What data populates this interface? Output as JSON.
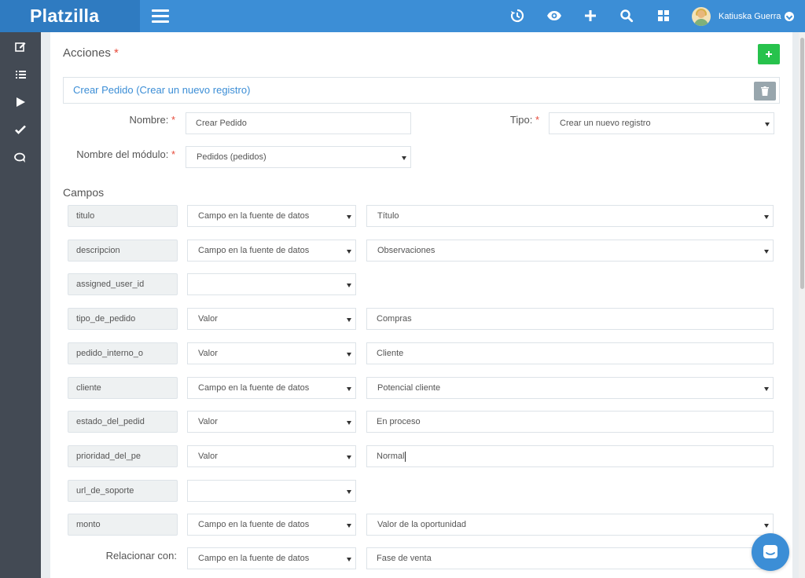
{
  "app": {
    "brand": "Platzilla"
  },
  "user": {
    "name": "Katiuska Guerra"
  },
  "topbar_icons": [
    "history-icon",
    "eye-icon",
    "plus-icon",
    "search-icon",
    "grid-icon"
  ],
  "sidebar_icons": [
    "edit-icon",
    "list-icon",
    "play-icon",
    "check-icon",
    "comments-icon"
  ],
  "page": {
    "title": "Acciones",
    "required_mark": "*"
  },
  "action": {
    "title": "Crear Pedido (Crear un nuevo registro)"
  },
  "form": {
    "nombre_label": "Nombre:",
    "nombre_value": "Crear Pedido",
    "tipo_label": "Tipo:",
    "tipo_value": "Crear un nuevo registro",
    "modulo_label": "Nombre del módulo:",
    "modulo_value": "Pedidos (pedidos)"
  },
  "campos": {
    "title": "Campos",
    "rows": [
      {
        "field": "titulo",
        "source": "Campo en la fuente de datos",
        "value": "Título",
        "value_type": "select"
      },
      {
        "field": "descripcion",
        "source": "Campo en la fuente de datos",
        "value": "Observaciones",
        "value_type": "select"
      },
      {
        "field": "assigned_user_id",
        "source": "",
        "value": "",
        "value_type": "none"
      },
      {
        "field": "tipo_de_pedido",
        "source": "Valor",
        "value": "Compras",
        "value_type": "input"
      },
      {
        "field": "pedido_interno_o",
        "source": "Valor",
        "value": "Cliente",
        "value_type": "input"
      },
      {
        "field": "cliente",
        "source": "Campo en la fuente de datos",
        "value": "Potencial cliente",
        "value_type": "select"
      },
      {
        "field": "estado_del_pedid",
        "source": "Valor",
        "value": "En proceso",
        "value_type": "input"
      },
      {
        "field": "prioridad_del_pe",
        "source": "Valor",
        "value": "Normal",
        "value_type": "input"
      },
      {
        "field": "url_de_soporte",
        "source": "",
        "value": "",
        "value_type": "none"
      },
      {
        "field": "monto",
        "source": "Campo en la fuente de datos",
        "value": "Valor de la oportunidad",
        "value_type": "select"
      }
    ]
  },
  "relacionar": {
    "label": "Relacionar con:",
    "source": "Campo en la fuente de datos",
    "value": "Fase de venta"
  },
  "colors": {
    "primary": "#3c8ed6",
    "sidebar": "#434a54",
    "success": "#27c24c",
    "required": "#e74c3c"
  }
}
